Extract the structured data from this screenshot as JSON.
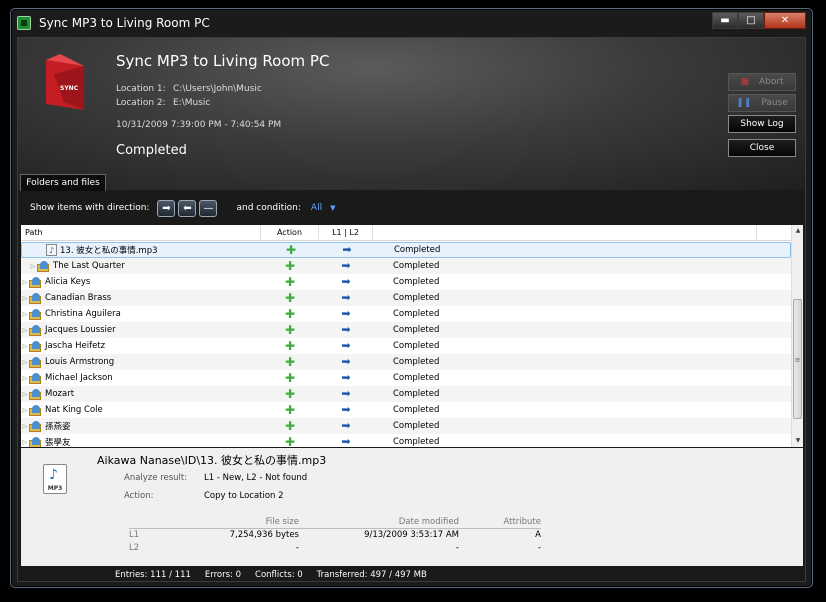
{
  "window": {
    "title": "Sync MP3 to Living Room PC",
    "controls": {
      "minimize": "▬",
      "maximize": "□",
      "close": "✕"
    }
  },
  "header": {
    "title": "Sync MP3 to Living Room PC",
    "logo_text": "SYNC",
    "location1_label": "Location 1:",
    "location1_value": "C:\\Users\\John\\Music",
    "location2_label": "Location 2:",
    "location2_value": "E:\\Music",
    "time_range": "10/31/2009 7:39:00 PM - 7:40:54 PM",
    "status": "Completed"
  },
  "buttons": {
    "abort": "Abort",
    "pause": "Pause",
    "show_log": "Show Log",
    "close": "Close"
  },
  "tab": {
    "label": "Folders and files"
  },
  "filter": {
    "direction_label": "Show items with direction:",
    "dir_right": "➡",
    "dir_left": "⬅",
    "dir_none": "—",
    "condition_label": "and condition:",
    "condition_value": "All",
    "condition_arrow": "▼"
  },
  "grid": {
    "columns": {
      "path": "Path",
      "action": "Action",
      "direction": "L1 | L2"
    },
    "rows": [
      {
        "name": "13. 彼女と私の事情.mp3",
        "type": "file",
        "action": "✚",
        "direction": "➡",
        "status": "Completed"
      },
      {
        "name": "The Last Quarter",
        "type": "folder",
        "action": "✚",
        "direction": "➡",
        "status": "Completed"
      },
      {
        "name": "Alicia Keys",
        "type": "folder",
        "action": "✚",
        "direction": "➡",
        "status": "Completed"
      },
      {
        "name": "Canadian Brass",
        "type": "folder",
        "action": "✚",
        "direction": "➡",
        "status": "Completed"
      },
      {
        "name": "Christina Aguilera",
        "type": "folder",
        "action": "✚",
        "direction": "➡",
        "status": "Completed"
      },
      {
        "name": "Jacques Loussier",
        "type": "folder",
        "action": "✚",
        "direction": "➡",
        "status": "Completed"
      },
      {
        "name": "Jascha Heifetz",
        "type": "folder",
        "action": "✚",
        "direction": "➡",
        "status": "Completed"
      },
      {
        "name": "Louis Armstrong",
        "type": "folder",
        "action": "✚",
        "direction": "➡",
        "status": "Completed"
      },
      {
        "name": "Michael Jackson",
        "type": "folder",
        "action": "✚",
        "direction": "➡",
        "status": "Completed"
      },
      {
        "name": "Mozart",
        "type": "folder",
        "action": "✚",
        "direction": "➡",
        "status": "Completed"
      },
      {
        "name": "Nat King Cole",
        "type": "folder",
        "action": "✚",
        "direction": "➡",
        "status": "Completed"
      },
      {
        "name": "孫燕姿",
        "type": "folder",
        "action": "✚",
        "direction": "➡",
        "status": "Completed"
      },
      {
        "name": "張學友",
        "type": "folder",
        "action": "✚",
        "direction": "➡",
        "status": "Completed"
      }
    ]
  },
  "details": {
    "path": "Aikawa Nanase\\ID\\13. 彼女と私の事情.mp3",
    "icon_label": "MP3",
    "analyze_label": "Analyze result:",
    "analyze_value": "L1 - New,  L2 - Not found",
    "action_label": "Action:",
    "action_value": "Copy to Location 2",
    "table": {
      "headers": [
        "",
        "File size",
        "Date modified",
        "Attribute"
      ],
      "rows": [
        [
          "L1",
          "7,254,936 bytes",
          "9/13/2009 3:53:17 AM",
          "A"
        ],
        [
          "L2",
          "-",
          "-",
          "-"
        ]
      ]
    }
  },
  "statusbar": {
    "entries": "Entries: 111 / 111",
    "errors": "Errors: 0",
    "conflicts": "Conflicts: 0",
    "transferred": "Transferred: 497 / 497 MB"
  }
}
